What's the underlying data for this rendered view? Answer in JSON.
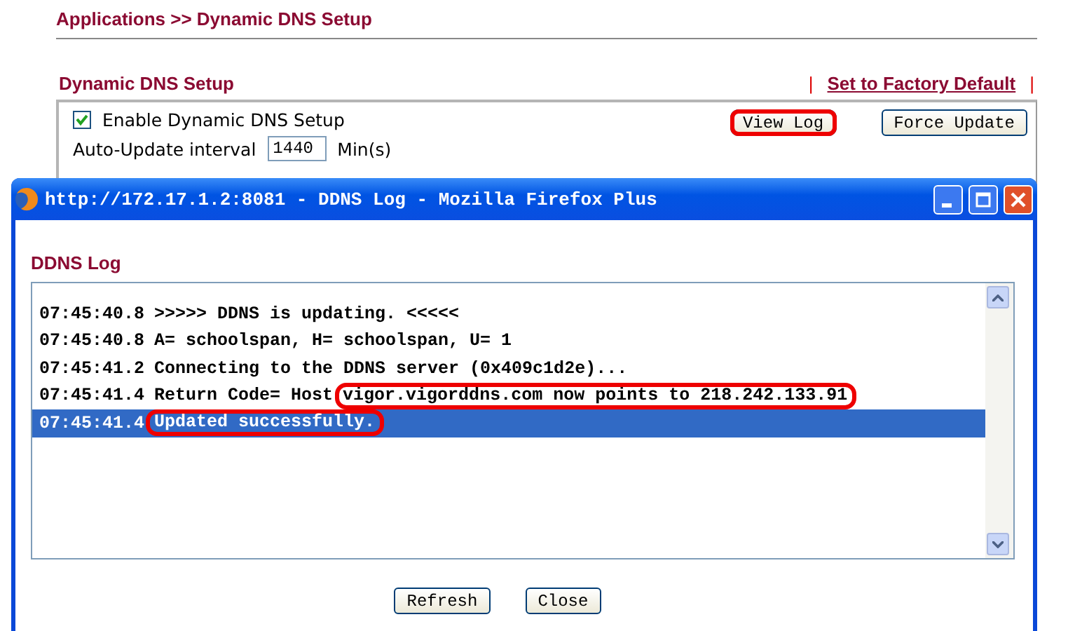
{
  "page": {
    "breadcrumb": "Applications >> Dynamic DNS Setup",
    "section_title": "Dynamic DNS Setup",
    "link_separators": [
      "|",
      "|"
    ],
    "factory_default_link": "Set to Factory Default",
    "enable": {
      "label": "Enable Dynamic DNS Setup",
      "checked": true
    },
    "interval": {
      "label": "Auto-Update interval",
      "value": "1440",
      "unit": "Min(s)"
    },
    "buttons": [
      {
        "label": "View Log",
        "highlighted": true
      },
      {
        "label": "Force Update",
        "highlighted": false
      }
    ]
  },
  "popup": {
    "title": "http://172.17.1.2:8081 - DDNS Log - Mozilla Firefox Plus",
    "heading": "DDNS Log",
    "log_lines": [
      {
        "time": "07:45:40.8",
        "selected": false,
        "segments": [
          {
            "text": ">>>>> DDNS is updating. <<<<<",
            "highlighted": false
          }
        ]
      },
      {
        "time": "07:45:40.8",
        "selected": false,
        "segments": [
          {
            "text": "A= schoolspan, H= schoolspan, U= 1",
            "highlighted": false
          }
        ]
      },
      {
        "time": "07:45:41.2",
        "selected": false,
        "segments": [
          {
            "text": "Connecting to the DDNS server (0x409c1d2e)...",
            "highlighted": false
          }
        ]
      },
      {
        "time": "07:45:41.4",
        "selected": false,
        "segments": [
          {
            "text": "Return Code= Host",
            "highlighted": false
          },
          {
            "text": "vigor.vigorddns.com now points to 218.242.133.91",
            "highlighted": true
          }
        ]
      },
      {
        "time": "07:45:41.4",
        "selected": true,
        "segments": [
          {
            "text": "Updated successfully.",
            "highlighted": true
          }
        ]
      }
    ],
    "buttons": [
      {
        "label": "Refresh"
      },
      {
        "label": "Close"
      }
    ]
  }
}
